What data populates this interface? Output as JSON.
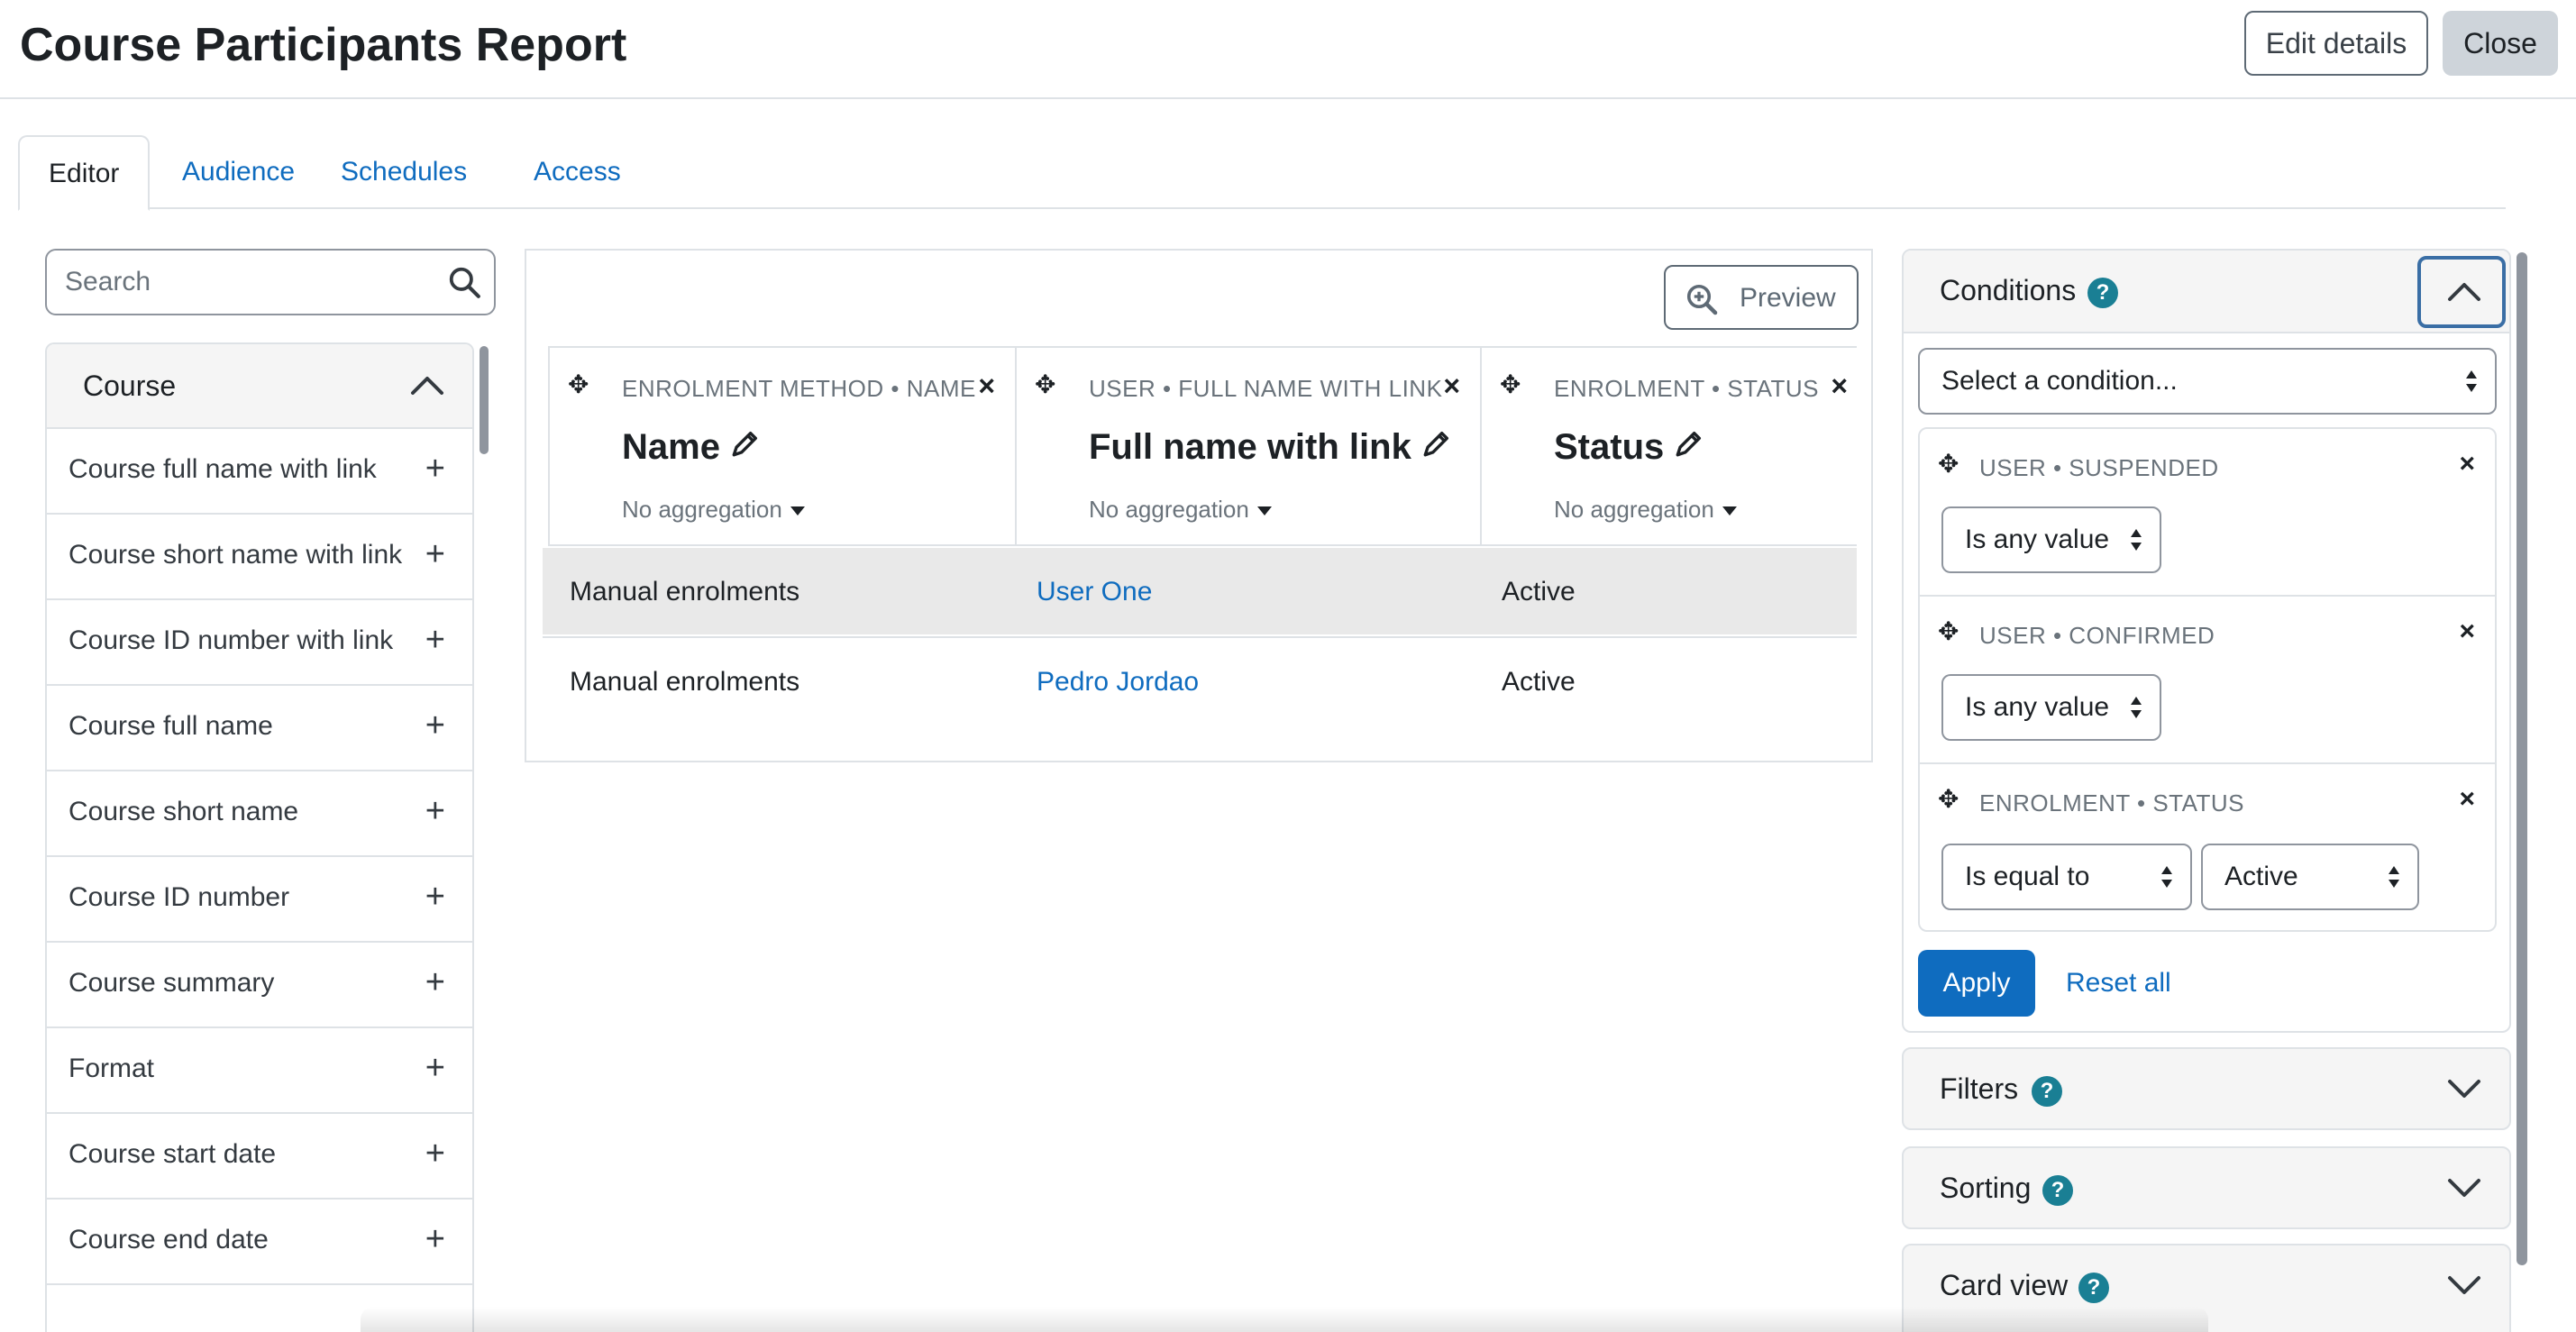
{
  "header": {
    "title": "Course Participants Report",
    "edit_label": "Edit details",
    "close_label": "Close"
  },
  "tabs": [
    {
      "label": "Editor",
      "active": true
    },
    {
      "label": "Audience"
    },
    {
      "label": "Schedules"
    },
    {
      "label": "Access"
    }
  ],
  "sidebar": {
    "search_placeholder": "Search",
    "section_title": "Course",
    "items": [
      "Course full name with link",
      "Course short name with link",
      "Course ID number with link",
      "Course full name",
      "Course short name",
      "Course ID number",
      "Course summary",
      "Format",
      "Course start date",
      "Course end date"
    ]
  },
  "report": {
    "preview_label": "Preview",
    "columns": [
      {
        "crumb": "ENROLMENT METHOD • NAME",
        "name": "Name",
        "aggregation": "No aggregation"
      },
      {
        "crumb": "USER • FULL NAME WITH LINK",
        "name": "Full name with link",
        "aggregation": "No aggregation"
      },
      {
        "crumb": "ENROLMENT • STATUS",
        "name": "Status",
        "aggregation": "No aggregation"
      }
    ],
    "rows": [
      [
        "Manual enrolments",
        "User One",
        "Active"
      ],
      [
        "Manual enrolments",
        "Pedro Jordao",
        "Active"
      ]
    ]
  },
  "conditions": {
    "title": "Conditions",
    "help": "?",
    "select_placeholder": "Select a condition...",
    "items": [
      {
        "crumb": "USER • SUSPENDED",
        "operator": "Is any value"
      },
      {
        "crumb": "USER • CONFIRMED",
        "operator": "Is any value"
      },
      {
        "crumb": "ENROLMENT • STATUS",
        "operator": "Is equal to",
        "value": "Active"
      }
    ],
    "apply_label": "Apply",
    "reset_label": "Reset all"
  },
  "panels": [
    {
      "title": "Filters"
    },
    {
      "title": "Sorting"
    },
    {
      "title": "Card view"
    }
  ],
  "icons": {
    "move": "✥",
    "remove": "×",
    "add": "+"
  },
  "colors": {
    "link": "#0f6cbf",
    "help_badge": "#1a7f94",
    "primary_button": "#0f6cbf"
  }
}
